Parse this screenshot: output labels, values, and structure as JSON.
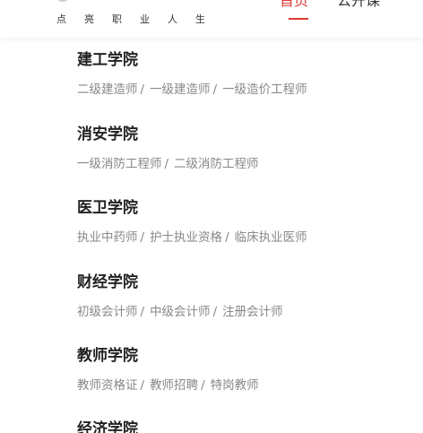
{
  "header": {
    "slogan": [
      "点",
      "亮",
      "职",
      "业",
      "人",
      "生"
    ],
    "nav": [
      {
        "label": "首页",
        "active": true
      },
      {
        "label": "公开课",
        "active": false
      }
    ]
  },
  "colors": {
    "accent": "#e03a32",
    "title": "#222222",
    "link": "#888888"
  },
  "sections": [
    {
      "title": "建工学院",
      "links": [
        "二级建造师",
        "一级建造师",
        "一级造价工程师"
      ]
    },
    {
      "title": "消安学院",
      "links": [
        "一级消防工程师",
        "二级消防工程师"
      ]
    },
    {
      "title": "医卫学院",
      "links": [
        "执业中药师",
        "护士执业资格",
        "临床执业医师"
      ]
    },
    {
      "title": "财经学院",
      "links": [
        "初级会计师",
        "中级会计师",
        "注册会计师"
      ]
    },
    {
      "title": "教师学院",
      "links": [
        "教师资格证",
        "教师招聘",
        "特岗教师"
      ]
    },
    {
      "title": "经济学院",
      "links": []
    }
  ]
}
